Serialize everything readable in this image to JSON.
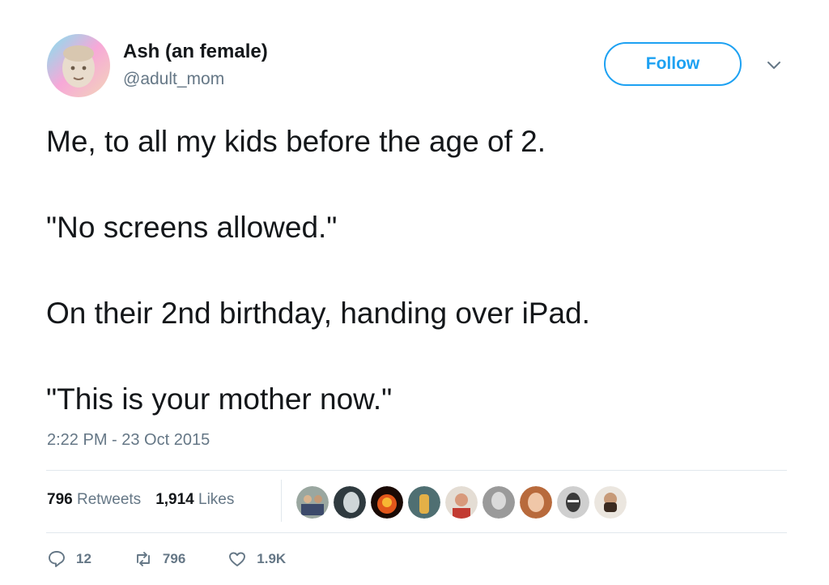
{
  "author": {
    "name": "Ash (an female)",
    "handle": "@adult_mom"
  },
  "follow_label": "Follow",
  "tweet": {
    "lines": [
      "Me, to all my kids before the age of 2.",
      "\"No screens allowed.\"",
      "On their 2nd birthday, handing over iPad.",
      "\"This is your mother now.\""
    ],
    "timestamp": "2:22 PM - 23 Oct 2015"
  },
  "stats": {
    "retweets_count": "796",
    "retweets_label": "Retweets",
    "likes_count": "1,914",
    "likes_label": "Likes"
  },
  "actions": {
    "replies": "12",
    "retweets": "796",
    "likes": "1.9K"
  },
  "colors": {
    "accent": "#1da1f2",
    "muted": "#657786",
    "text": "#14171a",
    "divider": "#e1e8ed"
  },
  "icons": [
    "chevron-down-icon",
    "reply-icon",
    "retweet-icon",
    "heart-icon"
  ]
}
